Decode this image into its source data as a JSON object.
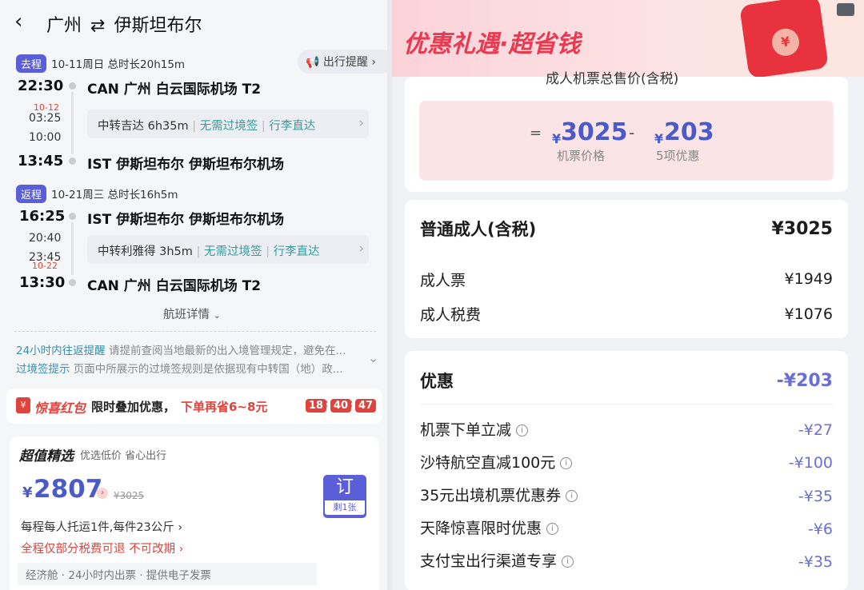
{
  "header": {
    "origin": "广州",
    "arrow": "⇄",
    "destination": "伊斯坦布尔"
  },
  "reminder_btn": "出行提醒",
  "outbound": {
    "tag": "去程",
    "summary": "10-11周日 总时长20h15m",
    "dep_time": "22:30",
    "dep_airport": "CAN 广州 白云国际机场 T2",
    "t_date": "10-12",
    "t_arr": "03:25",
    "t_dep": "10:00",
    "transfer": "中转吉达 6h35m",
    "no_visa": "无需过境签",
    "baggage": "行李直达",
    "arr_time": "13:45",
    "arr_airport": "IST 伊斯坦布尔 伊斯坦布尔机场"
  },
  "return": {
    "tag": "返程",
    "summary": "10-21周三 总时长16h5m",
    "dep_time": "16:25",
    "dep_airport": "IST 伊斯坦布尔 伊斯坦布尔机场",
    "t_arr": "20:40",
    "t_dep": "23:45",
    "t_date": "10-22",
    "transfer": "中转利雅得 3h5m",
    "no_visa": "无需过境签",
    "baggage": "行李直达",
    "arr_time": "13:30",
    "arr_airport": "CAN 广州 白云国际机场 T2"
  },
  "flight_details": "航班详情",
  "notices": [
    {
      "title": "24小时内往返提醒",
      "text": "请提前查阅当地最新的出入境管理规定，避免在..."
    },
    {
      "title": "过境签提示",
      "text": "页面中所展示的过境签规则是依据现有中转国（地）政..."
    }
  ],
  "redpacket": {
    "icon": "¥",
    "name": "惊喜红包",
    "text": "限时叠加优惠，",
    "save": "下单再省6~8元",
    "t1": "18",
    "t2": "40",
    "t3": "47"
  },
  "offer": {
    "title": "超值精选",
    "subtitle": "优选低价 省心出行",
    "price_sym": "¥",
    "price": "2807",
    "orig": "¥3025",
    "book": "订",
    "remaining": "剩1张",
    "baggage": "每程每人托运1件,每件23公斤",
    "refund": "全程仅部分税费可退 不可改期",
    "extra": "经济舱 · 24小时内出票 · 提供电子发票"
  },
  "promo": {
    "banner": "优惠礼遇·超省钱",
    "cut_text": "成人机票总售价(含税)",
    "eq": "=",
    "price_sym": "¥",
    "price": "3025",
    "price_label": "机票价格",
    "minus": "-",
    "disc_sym": "¥",
    "disc": "203",
    "disc_label": "5项优惠"
  },
  "fare": {
    "title": "普通成人(含税)",
    "total": "¥3025",
    "rows": [
      {
        "label": "成人票",
        "value": "¥1949"
      },
      {
        "label": "成人税费",
        "value": "¥1076"
      }
    ]
  },
  "discounts": {
    "title": "优惠",
    "total": "-¥203",
    "rows": [
      {
        "label": "机票下单立减",
        "value": "-¥27"
      },
      {
        "label": "沙特航空直减100元",
        "value": "-¥100"
      },
      {
        "label": "35元出境机票优惠券",
        "value": "-¥35"
      },
      {
        "label": "天降惊喜限时优惠",
        "value": "-¥6"
      },
      {
        "label": "支付宝出行渠道专享",
        "value": "-¥35"
      }
    ]
  },
  "colors": {
    "accent": "#5a5fd8",
    "red": "#e0433b",
    "teal": "#3a9a9a"
  }
}
